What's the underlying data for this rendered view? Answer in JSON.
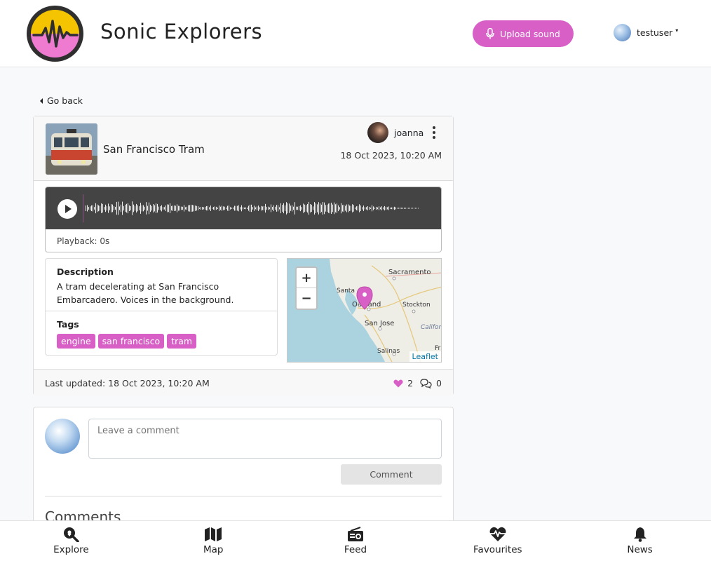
{
  "header": {
    "brand": "Sonic Explorers",
    "upload_label": "Upload sound",
    "username": "testuser",
    "accent": "#d85fc6"
  },
  "nav": {
    "back_label": "Go back"
  },
  "sound": {
    "title": "San Francisco Tram",
    "author": "joanna",
    "date": "18 Oct 2023, 10:20 AM",
    "playback": "Playback: 0s",
    "description_title": "Description",
    "description": "A tram decelerating at San Francisco Embarcadero. Voices in the background.",
    "tags_title": "Tags",
    "tags": [
      "engine",
      "san francisco",
      "tram"
    ],
    "last_updated": "Last updated: 18 Oct 2023, 10:20 AM",
    "likes": "2",
    "comments_count": "0"
  },
  "map": {
    "zoom_in": "+",
    "zoom_out": "−",
    "attribution": "Leaflet",
    "labels": {
      "sacramento": "Sacramento",
      "santa": "Santa",
      "oakland": "Oakland",
      "stockton": "Stockton",
      "sanjose": "San Jose",
      "california": "Californ",
      "salinas": "Salinas",
      "fr": "Fr"
    }
  },
  "comment_form": {
    "placeholder": "Leave a comment",
    "submit_label": "Comment",
    "comments_title": "Comments"
  },
  "bottom_nav": [
    {
      "label": "Explore",
      "icon": "search-location-icon"
    },
    {
      "label": "Map",
      "icon": "map-icon"
    },
    {
      "label": "Feed",
      "icon": "radio-icon"
    },
    {
      "label": "Favourites",
      "icon": "heartbeat-icon"
    },
    {
      "label": "News",
      "icon": "bell-icon"
    }
  ]
}
